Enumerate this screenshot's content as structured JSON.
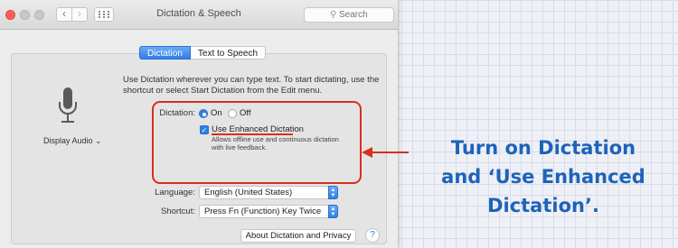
{
  "window": {
    "title": "Dictation & Speech",
    "search_placeholder": "Search"
  },
  "tabs": [
    {
      "label": "Dictation",
      "active": true
    },
    {
      "label": "Text to Speech",
      "active": false
    }
  ],
  "intro_text": "Use Dictation wherever you can type text. To start dictating, use the shortcut or select Start Dictation from the Edit menu.",
  "microphone": {
    "label": "Display Audio ⌄",
    "icon": "microphone-icon"
  },
  "dictation": {
    "label": "Dictation:",
    "on_label": "On",
    "off_label": "Off",
    "selected": "On"
  },
  "enhanced": {
    "label": "Use Enhanced Dictation",
    "checked": true,
    "description": "Allows offline use and continuous dictation with live feedback."
  },
  "language": {
    "label": "Language:",
    "value": "English (United States)"
  },
  "shortcut": {
    "label": "Shortcut:",
    "value": "Press Fn (Function) Key Twice"
  },
  "about_button": "About Dictation and Privacy",
  "help_button": "?",
  "annotation": {
    "line1": "Turn on Dictation",
    "line2": "and ‘Use Enhanced",
    "line3": "Dictation’.",
    "color": "#1e63b8",
    "highlight_color": "#d6301c"
  },
  "colors": {
    "accent": "#2f7fe8",
    "close": "#fc5f57"
  }
}
